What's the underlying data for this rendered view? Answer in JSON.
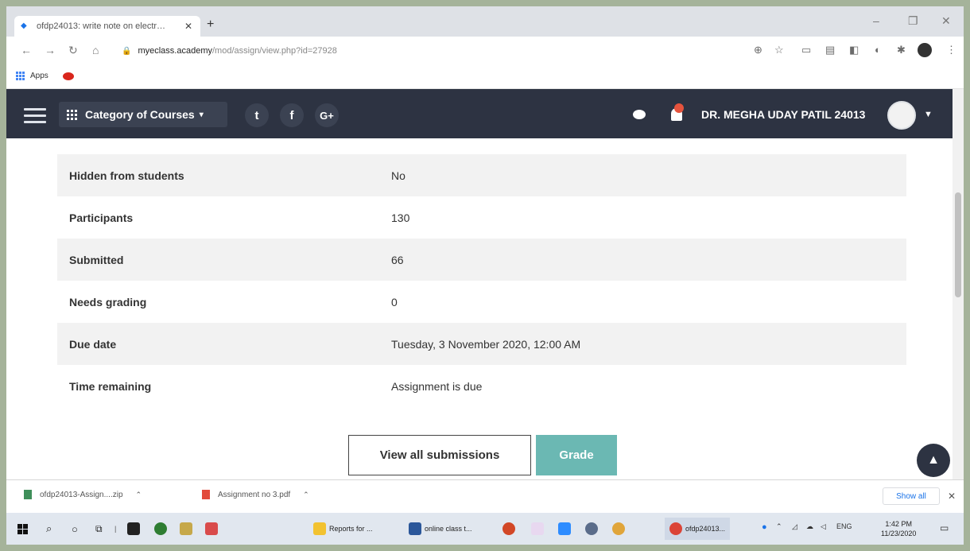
{
  "browser": {
    "tab_title": "ofdp24013: write note on electr…",
    "url_host": "myeclass.academy",
    "url_path": "/mod/assign/view.php?id=27928",
    "bookmark_apps": "Apps"
  },
  "navbar": {
    "category_label": "Category of Courses",
    "social": [
      "t",
      "f",
      "G+"
    ],
    "user_name": "DR. MEGHA UDAY PATIL 24013"
  },
  "grading_summary": [
    {
      "label": "Hidden from students",
      "value": "No"
    },
    {
      "label": "Participants",
      "value": "130"
    },
    {
      "label": "Submitted",
      "value": "66"
    },
    {
      "label": "Needs grading",
      "value": "0"
    },
    {
      "label": "Due date",
      "value": "Tuesday, 3 November 2020, 12:00 AM"
    },
    {
      "label": "Time remaining",
      "value": "Assignment is due"
    }
  ],
  "actions": {
    "view_all": "View all submissions",
    "grade": "Grade"
  },
  "downloads": {
    "items": [
      {
        "name": "ofdp24013-Assign....zip"
      },
      {
        "name": "Assignment no 3.pdf"
      }
    ],
    "show_all": "Show all"
  },
  "taskbar": {
    "apps": [
      {
        "label": "Reports for ..."
      },
      {
        "label": "online class t..."
      },
      {
        "label": "ofdp24013..."
      }
    ],
    "lang": "ENG",
    "time": "1:42 PM",
    "date": "11/23/2020"
  },
  "colors": {
    "navbar_bg": "#2d3342",
    "grade_button": "#6bb8b3",
    "row_shade": "#f2f2f2",
    "outer_border": "#a5b39a"
  }
}
